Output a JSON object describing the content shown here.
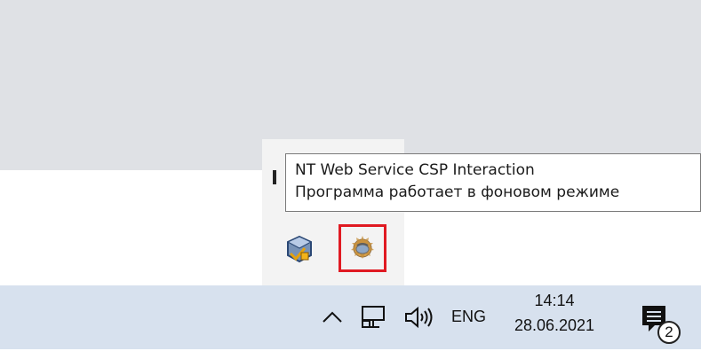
{
  "tooltip": {
    "title": "NT Web Service CSP Interaction",
    "status": "Программа работает в фоновом режиме"
  },
  "tray_icons": [
    {
      "name": "virtualbox-icon"
    },
    {
      "name": "nt-web-service-icon",
      "highlight_color": "#e01a22"
    }
  ],
  "taskbar": {
    "language": "ENG",
    "time": "14:14",
    "date": "28.06.2021",
    "notification_count": "2",
    "icons": [
      "chevron-up-icon",
      "network-icon",
      "volume-icon",
      "action-center-icon"
    ]
  },
  "colors": {
    "taskbar_bg": "#d7e1ee",
    "flyout_bg": "#f3f3f3",
    "top_bg": "#dfe1e5",
    "highlight": "#e01a22"
  }
}
